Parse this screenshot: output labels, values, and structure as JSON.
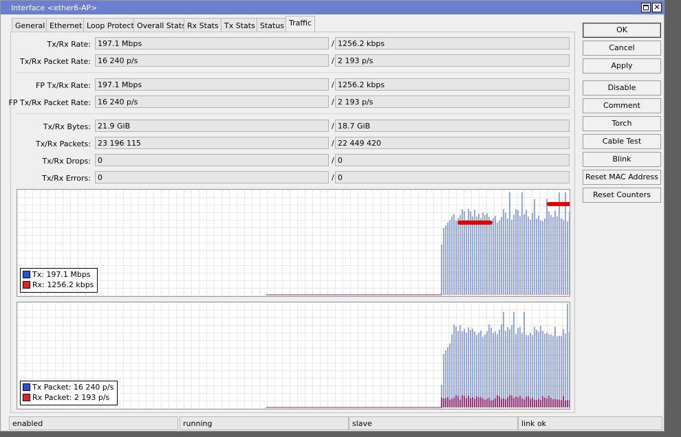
{
  "window": {
    "title": "Interface <ether6-AP>"
  },
  "tabs": [
    {
      "label": "General"
    },
    {
      "label": "Ethernet"
    },
    {
      "label": "Loop Protect"
    },
    {
      "label": "Overall Stats"
    },
    {
      "label": "Rx Stats"
    },
    {
      "label": "Tx Stats"
    },
    {
      "label": "Status"
    },
    {
      "label": "Traffic",
      "active": true
    }
  ],
  "fields": {
    "txrx_rate": {
      "label": "Tx/Rx Rate:",
      "tx": "197.1 Mbps",
      "rx": "1256.2 kbps"
    },
    "txrx_packet_rate": {
      "label": "Tx/Rx Packet Rate:",
      "tx": "16 240 p/s",
      "rx": "2 193 p/s"
    },
    "fp_txrx_rate": {
      "label": "FP Tx/Rx Rate:",
      "tx": "197.1 Mbps",
      "rx": "1256.2 kbps"
    },
    "fp_txrx_packet_rate": {
      "label": "FP Tx/Rx Packet Rate:",
      "tx": "16 240 p/s",
      "rx": "2 193 p/s"
    },
    "txrx_bytes": {
      "label": "Tx/Rx Bytes:",
      "tx": "21.9 GiB",
      "rx": "18.7 GiB"
    },
    "txrx_packets": {
      "label": "Tx/Rx Packets:",
      "tx": "23 196 115",
      "rx": "22 449 420"
    },
    "txrx_drops": {
      "label": "Tx/Rx Drops:",
      "tx": "0",
      "rx": "0"
    },
    "txrx_errors": {
      "label": "Tx/Rx Errors:",
      "tx": "0",
      "rx": "0"
    },
    "separator": "/"
  },
  "graphs": {
    "traffic": {
      "legend": [
        {
          "label": "Tx:",
          "value": "197.1 Mbps",
          "color": "#2b4fe0"
        },
        {
          "label": "Rx:",
          "value": "1256.2 kbps",
          "color": "#e12222"
        }
      ]
    },
    "packets": {
      "legend": [
        {
          "label": "Tx Packet:",
          "value": "16 240 p/s",
          "color": "#2b4fe0"
        },
        {
          "label": "Rx Packet:",
          "value": "2 193 p/s",
          "color": "#e12222"
        }
      ]
    }
  },
  "buttons": {
    "ok": "OK",
    "cancel": "Cancel",
    "apply": "Apply",
    "disable": "Disable",
    "comment": "Comment",
    "torch": "Torch",
    "cable_test": "Cable Test",
    "blink": "Blink",
    "reset_mac": "Reset MAC Address",
    "reset_counters": "Reset Counters"
  },
  "status": [
    "enabled",
    "running",
    "slave",
    "link ok"
  ],
  "colors": {
    "titlebar": "#6a7fd0",
    "tx": "#2b4fe0",
    "rx": "#e12222",
    "annotation": "#e00000"
  }
}
